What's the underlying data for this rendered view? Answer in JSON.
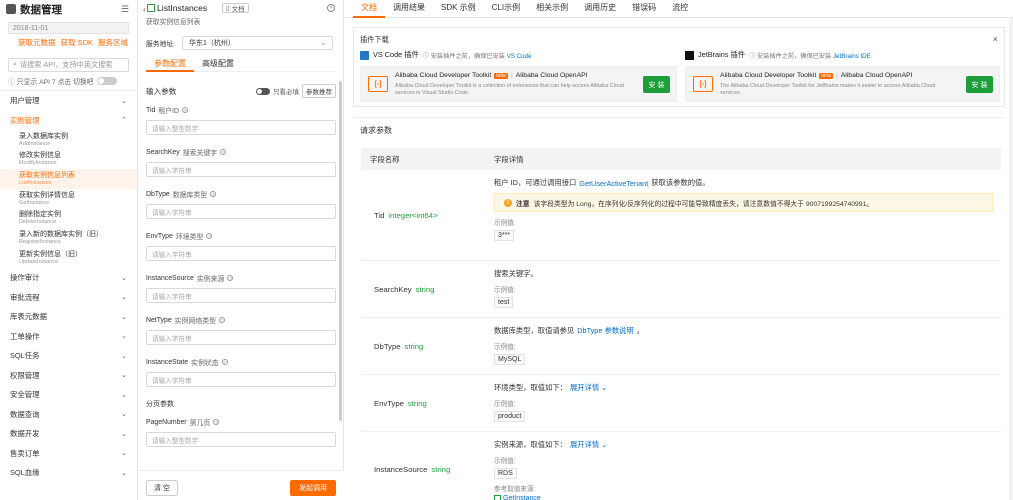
{
  "sidebar": {
    "title": "数据管理",
    "date": "2018-11-01",
    "quick_links": [
      "获取元数据",
      "获取 SDK",
      "服务区域"
    ],
    "search_placeholder": "请搜索 API，支持中英文搜索",
    "api_only_label": "只显示 API 7 点击 切换吧",
    "groups_top": [
      {
        "label": "用户管理",
        "active": false
      },
      {
        "label": "实例管理",
        "active": true
      }
    ],
    "sub_items": [
      {
        "zh": "录入数据库实例",
        "en": "AddInstance",
        "selected": false
      },
      {
        "zh": "修改实例信息",
        "en": "ModifyInstance",
        "selected": false
      },
      {
        "zh": "获取实例信息列表",
        "en": "ListInstances",
        "selected": true
      },
      {
        "zh": "获取实例详情信息",
        "en": "GetInstance",
        "selected": false
      },
      {
        "zh": "删除指定实例",
        "en": "DeleteInstance",
        "selected": false
      },
      {
        "zh": "录入新的数据库实例（旧）",
        "en": "RegisterInstance",
        "selected": false
      },
      {
        "zh": "更新实例信息（旧）",
        "en": "UpdateInstance",
        "selected": false
      }
    ],
    "groups_bottom": [
      "操作审计",
      "审批流程",
      "库表元数据",
      "工单操作",
      "SQL任务",
      "权限管理",
      "安全管理",
      "数据查询",
      "数据开发",
      "售卖订单",
      "SQL血缘"
    ]
  },
  "middle": {
    "api_name": "ListInstances",
    "doc_tag": "文档",
    "api_desc": "获取实例信息列表",
    "address_label": "服务地址:",
    "address_value": "华东1（杭州）",
    "tabs": [
      "参数配置",
      "高级配置"
    ],
    "input_params_label": "输入参数",
    "required_only_label": "只看必填",
    "recommend_label": "参数推荐",
    "fields": [
      {
        "name": "Tid",
        "zh": "租户ID",
        "placeholder": "请输入整型数字"
      },
      {
        "name": "SearchKey",
        "zh": "搜索关键字",
        "placeholder": "请输入字符串"
      },
      {
        "name": "DbType",
        "zh": "数据库类型",
        "placeholder": "请输入字符串"
      },
      {
        "name": "EnvType",
        "zh": "环境类型",
        "placeholder": "请输入字符串"
      },
      {
        "name": "InstanceSource",
        "zh": "实例来源",
        "placeholder": "请输入字符串"
      },
      {
        "name": "NetType",
        "zh": "实例网络类型",
        "placeholder": "请输入字符串"
      },
      {
        "name": "InstanceState",
        "zh": "实例状态",
        "placeholder": "请输入字符串"
      }
    ],
    "paging_label": "分页参数",
    "page_field": {
      "name": "PageNumber",
      "zh": "第几页",
      "placeholder": "请输入整型数字"
    },
    "clear_button": "清 空",
    "send_button": "发起调用"
  },
  "right": {
    "tabs": [
      "文档",
      "调用结果",
      "SDK 示例",
      "CLI示例",
      "相关示例",
      "调用历史",
      "错误码",
      "流控"
    ],
    "plugin_title": "插件下载",
    "plugins": [
      {
        "ide": "VS Code 插件",
        "hint": "安装插件之前，确保已安装",
        "hint_link": "VS Code",
        "name": "Alibaba Cloud Developer Toolkit",
        "beta": "beta",
        "sub": "Alibaba Cloud OpenAPI",
        "desc": "Alibaba Cloud Developer Toolkit is a collection of extensions that can help access Alibaba Cloud services in Visual Studio Code.",
        "install": "安 装"
      },
      {
        "ide": "JetBrains 插件",
        "hint": "安装插件之前，确保已安装",
        "hint_link": "JetBrains IDE",
        "name": "Alibaba Cloud Developer Toolkit",
        "beta": "beta",
        "sub": "Alibaba Cloud OpenAPI",
        "desc": "The Alibaba Cloud Developer Toolkit for JetBrains makes it easier to access Alibaba Cloud services.",
        "install": "安 装"
      }
    ],
    "request_params_title": "请求参数",
    "table_headers": [
      "字段名称",
      "字段详情"
    ],
    "params": [
      {
        "name": "Tid",
        "type": "integer<int64>",
        "desc_pre": "租户 ID，可通过调用接口",
        "desc_link": "GetUserActiveTenant",
        "desc_post": "获取该参数的值。",
        "note_bold": "注意",
        "note": "该字段类型为 Long，在序列化/反序列化的过程中可能导致精度丢失，请注意数值不得大于 9007199254740991。",
        "example_label": "示例值:",
        "example": "3***"
      },
      {
        "name": "SearchKey",
        "type": "string",
        "desc_pre": "搜索关键字。",
        "example_label": "示例值:",
        "example": "test"
      },
      {
        "name": "DbType",
        "type": "string",
        "desc_pre": "数据库类型，取值请参见",
        "desc_link": "DbType 参数说明",
        "desc_post": "。",
        "example_label": "示例值:",
        "example": "MySQL"
      },
      {
        "name": "EnvType",
        "type": "string",
        "desc_pre": "环境类型，取值如下：",
        "expand": "展开详情",
        "example_label": "示例值:",
        "example": "product"
      },
      {
        "name": "InstanceSource",
        "type": "string",
        "desc_pre": "实例来源，取值如下：",
        "expand": "展开详情",
        "example_label": "示例值:",
        "example": "RDS",
        "source_label": "参考取值来源:",
        "source_link": "GetInstance"
      }
    ]
  }
}
